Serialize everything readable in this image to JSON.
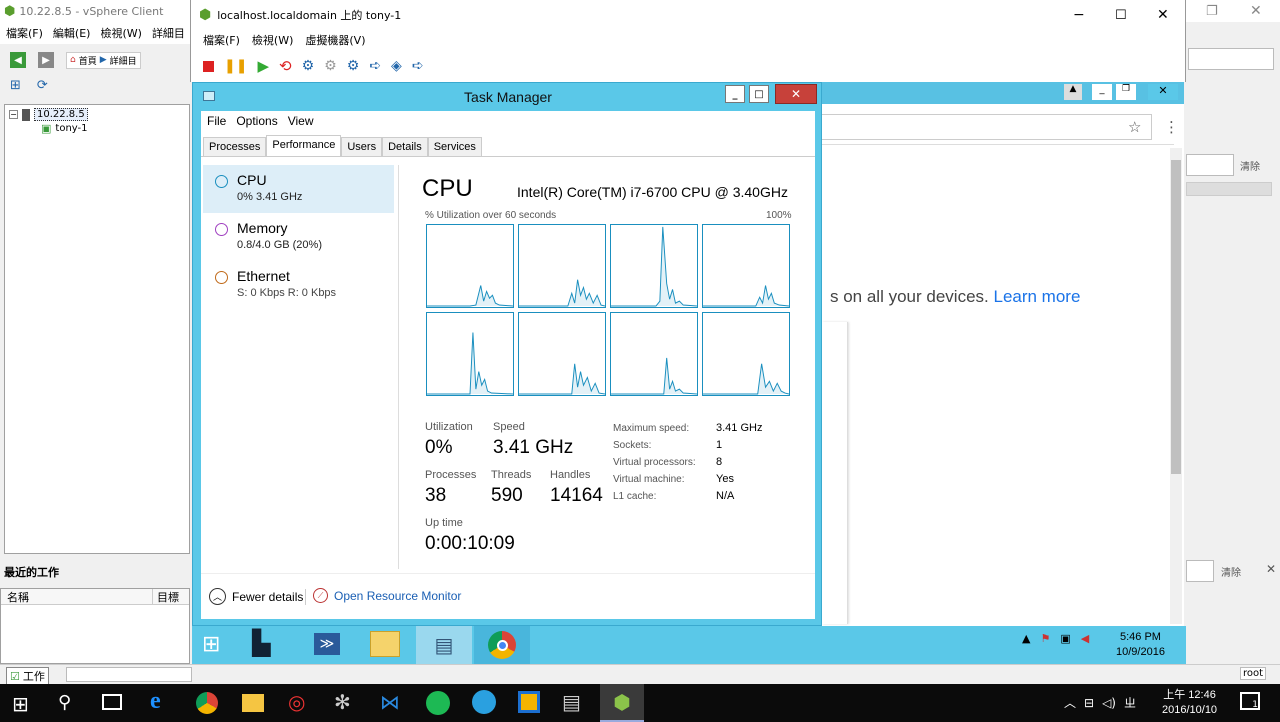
{
  "vsphere": {
    "title": "10.22.8.5 - vSphere Client",
    "menu": [
      "檔案(F)",
      "編輯(E)",
      "檢視(W)",
      "詳細目"
    ],
    "home_label": "首頁",
    "inventory_label": "詳細目",
    "tree_host": "10.22.8.5",
    "tree_vm": "tony-1",
    "recent_tasks_title": "最近的工作",
    "table_cols": [
      "名稱",
      "目標"
    ],
    "status_tasks": "工作",
    "clear_label": "清除",
    "user": "root"
  },
  "console": {
    "title": "localhost.localdomain 上的 tony-1",
    "menu": [
      "檔案(F)",
      "檢視(W)",
      "虛擬機器(V)"
    ]
  },
  "chrome": {
    "tagline": "s on all your devices.",
    "link": "Learn more"
  },
  "taskmgr": {
    "title": "Task Manager",
    "menu": [
      "File",
      "Options",
      "View"
    ],
    "tabs": [
      "Processes",
      "Performance",
      "Users",
      "Details",
      "Services"
    ],
    "active_tab": "Performance",
    "resources": [
      {
        "name": "CPU",
        "detail": "0% 3.41 GHz",
        "color": "#1a8fbf"
      },
      {
        "name": "Memory",
        "detail": "0.8/4.0 GB (20%)",
        "color": "#a040c0"
      },
      {
        "name": "Ethernet",
        "detail": "S: 0 Kbps R: 0 Kbps",
        "color": "#c06a1a"
      }
    ],
    "cpu_title": "CPU",
    "cpu_model": "Intel(R) Core(TM) i7-6700 CPU @ 3.40GHz",
    "graph_label": "% Utilization over 60 seconds",
    "graph_max": "100%",
    "stats": {
      "utilization_label": "Utilization",
      "utilization": "0%",
      "speed_label": "Speed",
      "speed": "3.41 GHz",
      "processes_label": "Processes",
      "processes": "38",
      "threads_label": "Threads",
      "threads": "590",
      "handles_label": "Handles",
      "handles": "14164",
      "uptime_label": "Up time",
      "uptime": "0:00:10:09"
    },
    "specs": [
      {
        "k": "Maximum speed:",
        "v": "3.41 GHz"
      },
      {
        "k": "Sockets:",
        "v": "1"
      },
      {
        "k": "Virtual processors:",
        "v": "8"
      },
      {
        "k": "Virtual machine:",
        "v": "Yes"
      },
      {
        "k": "L1 cache:",
        "v": "N/A"
      }
    ],
    "fewer_details": "Fewer details",
    "open_monitor": "Open Resource Monitor"
  },
  "guest_tray": {
    "time": "5:46 PM",
    "date": "10/9/2016"
  },
  "host_tray": {
    "time": "上午 12:46",
    "date": "2016/10/10",
    "notif_count": "1"
  }
}
